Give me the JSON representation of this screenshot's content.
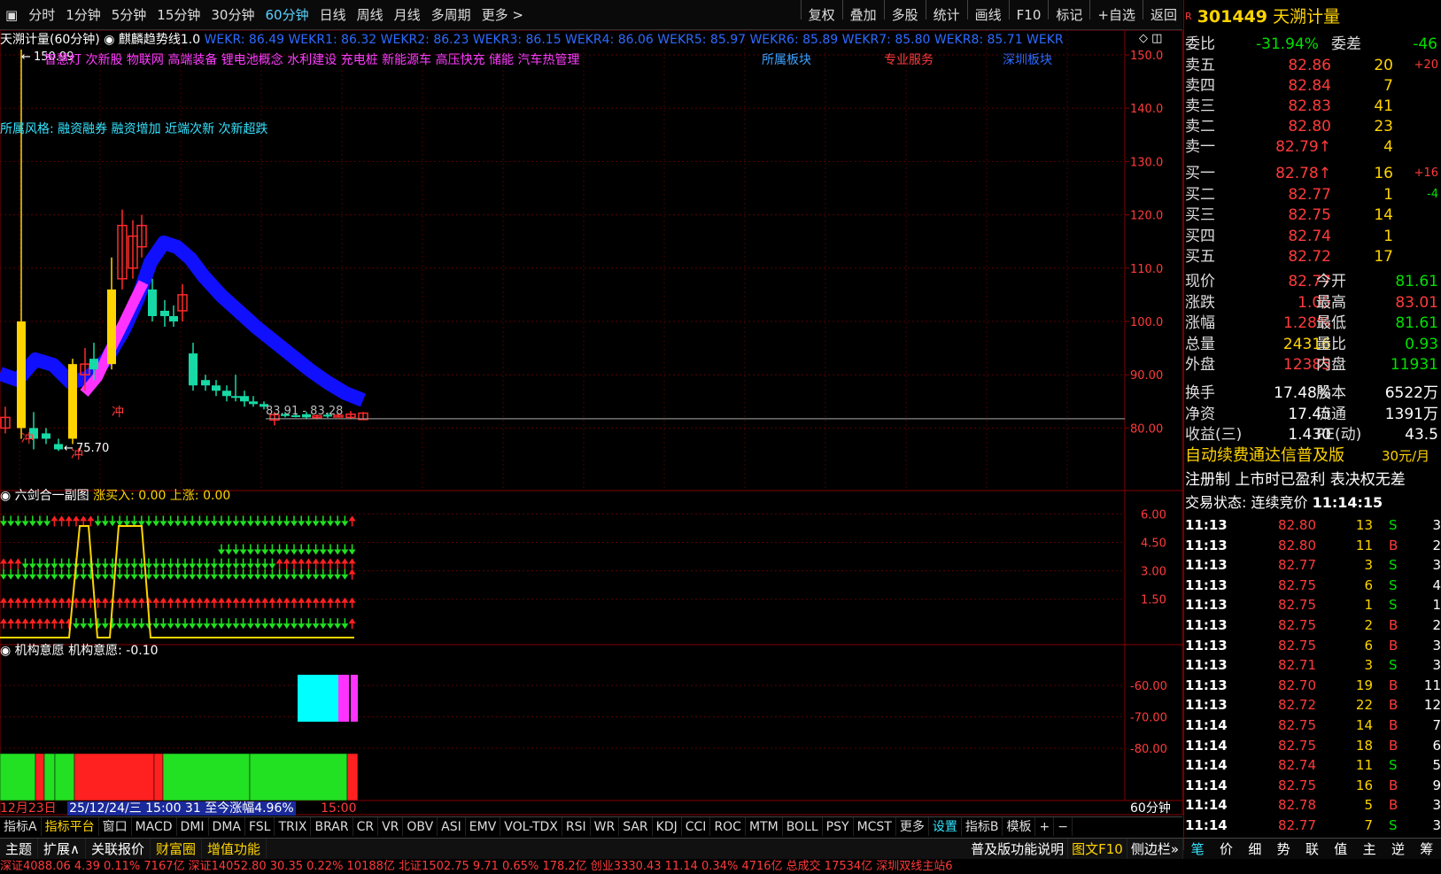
{
  "toolbar": {
    "periods": [
      "分时",
      "1分钟",
      "5分钟",
      "15分钟",
      "30分钟",
      "60分钟",
      "日线",
      "周线",
      "月线",
      "多周期",
      "更多 >"
    ],
    "active_period": "60分钟",
    "actions": [
      "复权",
      "叠加",
      "多股",
      "统计",
      "画线",
      "F10",
      "标记",
      "+自选",
      "返回"
    ]
  },
  "main_chart": {
    "title_left": "天溯计量(60分钟)",
    "indicator_name": "麒麟趋势线1.0",
    "wekr": "WEKR: 86.49 WEKR1: 86.32 WEKR2: 86.23 WEKR3: 86.15 WEKR4: 86.06 WEKR5: 85.97 WEKR6: 85.89 WEKR7: 85.80 WEKR8: 85.71 WEKR",
    "concepts": "智慧灯 次新股 物联网 高端装备 锂电池概念 水利建设 充电桩 新能源车 高压快充 储能 汽车热管理",
    "sector_label": "所属板块",
    "service_label": "专业服务",
    "region_label": "深圳板块",
    "style_label": "所属风格: 融资融券 融资增加 近端次新 次新超跌",
    "high_label": "150.99",
    "low_label": "75.70",
    "range_label": "83.91 - 83.28",
    "chong": "冲",
    "y_ticks": [
      "150.0",
      "140.0",
      "130.0",
      "120.0",
      "110.0",
      "100.0",
      "90.00",
      "80.00"
    ]
  },
  "sub1": {
    "title": "六剑合一副图",
    "value_text": "涨买入: 0.00 上涨: 0.00",
    "y_ticks": [
      "6.00",
      "4.50",
      "3.00",
      "1.50"
    ]
  },
  "sub2": {
    "title": "机构意愿",
    "value_text": "机构意愿: -0.10",
    "y_ticks": [
      "-60.00",
      "-70.00",
      "-80.00"
    ]
  },
  "time_axis": {
    "left_date": "12月23日",
    "range": "25/12/24/三 15:00 31 至今涨幅4.96%",
    "time": "15:00",
    "period_label": "60分钟"
  },
  "indicators": [
    "指标A",
    "指标平台",
    "窗口",
    "MACD",
    "DMI",
    "DMA",
    "FSL",
    "TRIX",
    "BRAR",
    "CR",
    "VR",
    "OBV",
    "ASI",
    "EMV",
    "VOL-TDX",
    "RSI",
    "WR",
    "SAR",
    "KDJ",
    "CCI",
    "ROC",
    "MTM",
    "BOLL",
    "PSY",
    "MCST",
    "更多",
    "设置",
    "指标B",
    "模板",
    "+",
    "−"
  ],
  "tabs": [
    "主题",
    "扩展∧",
    "关联报价",
    "财富圈",
    "增值功能"
  ],
  "tabs_right": [
    "普及版功能说明",
    "图文F10",
    "侧边栏»"
  ],
  "side_tabs": [
    "笔",
    "价",
    "细",
    "势",
    "联",
    "值",
    "主",
    "逆",
    "筹"
  ],
  "quote": {
    "code": "301449",
    "name": "天溯计量",
    "r_badge": "R",
    "weibi_label": "委比",
    "weibi": "-31.94%",
    "weicha_label": "委差",
    "weicha": "-46",
    "asks": [
      {
        "label": "卖五",
        "price": "82.86",
        "vol": "20",
        "chg": "+20"
      },
      {
        "label": "卖四",
        "price": "82.84",
        "vol": "7",
        "chg": ""
      },
      {
        "label": "卖三",
        "price": "82.83",
        "vol": "41",
        "chg": ""
      },
      {
        "label": "卖二",
        "price": "82.80",
        "vol": "23",
        "chg": ""
      },
      {
        "label": "卖一",
        "price": "82.79↑",
        "vol": "4",
        "chg": ""
      }
    ],
    "bids": [
      {
        "label": "买一",
        "price": "82.78↑",
        "vol": "16",
        "chg": "+16"
      },
      {
        "label": "买二",
        "price": "82.77",
        "vol": "1",
        "chg": "-4"
      },
      {
        "label": "买三",
        "price": "82.75",
        "vol": "14",
        "chg": ""
      },
      {
        "label": "买四",
        "price": "82.74",
        "vol": "1",
        "chg": ""
      },
      {
        "label": "买五",
        "price": "82.72",
        "vol": "17",
        "chg": ""
      }
    ],
    "stats": [
      {
        "l1": "现价",
        "v1": "82.77",
        "l2": "今开",
        "v2": "81.61"
      },
      {
        "l1": "涨跌",
        "v1": "1.05",
        "l2": "最高",
        "v2": "83.01"
      },
      {
        "l1": "涨幅",
        "v1": "1.28%",
        "l2": "最低",
        "v2": "81.61"
      },
      {
        "l1": "总量",
        "v1": "24316",
        "l2": "量比",
        "v2": "0.93"
      },
      {
        "l1": "外盘",
        "v1": "12385",
        "l2": "内盘",
        "v2": "11931"
      }
    ],
    "stats2": [
      {
        "l1": "换手",
        "v1": "17.48%",
        "l2": "股本",
        "v2": "6522万"
      },
      {
        "l1": "净资",
        "v1": "17.45",
        "l2": "流通",
        "v2": "1391万"
      },
      {
        "l1": "收益(三)",
        "v1": "1.430",
        "l2": "PE(动)",
        "v2": "43.5"
      }
    ],
    "promo": "自动续费通达信普及版",
    "promo_price": "30元/月",
    "notice": "注册制 上市时已盈利 表决权无差",
    "trade_state": "交易状态: 连续竞价",
    "trade_time": "11:14:15",
    "ticks": [
      [
        "11:13",
        "82.80",
        "13",
        "S",
        "3"
      ],
      [
        "11:13",
        "82.80",
        "11",
        "B",
        "2"
      ],
      [
        "11:13",
        "82.77",
        "3",
        "S",
        "3"
      ],
      [
        "11:13",
        "82.75",
        "6",
        "S",
        "4"
      ],
      [
        "11:13",
        "82.75",
        "1",
        "S",
        "1"
      ],
      [
        "11:13",
        "82.75",
        "2",
        "B",
        "2"
      ],
      [
        "11:13",
        "82.75",
        "6",
        "B",
        "3"
      ],
      [
        "11:13",
        "82.71",
        "3",
        "S",
        "3"
      ],
      [
        "11:13",
        "82.70",
        "19",
        "B",
        "11"
      ],
      [
        "11:13",
        "82.72",
        "22",
        "B",
        "12"
      ],
      [
        "11:14",
        "82.75",
        "14",
        "B",
        "7"
      ],
      [
        "11:14",
        "82.75",
        "18",
        "B",
        "6"
      ],
      [
        "11:14",
        "82.74",
        "11",
        "S",
        "5"
      ],
      [
        "11:14",
        "82.75",
        "16",
        "B",
        "9"
      ],
      [
        "11:14",
        "82.78",
        "5",
        "B",
        "3"
      ],
      [
        "11:14",
        "82.77",
        "7",
        "S",
        "3"
      ]
    ]
  },
  "status": "深证4088.06  4.39  0.11%  7167亿  深证14052.80  30.35  0.22%  10188亿 北证1502.75  9.71  0.65%  178.2亿  创业3330.43  11.14  0.34%  4716亿  总成交  17534亿  深圳双线主站6",
  "colors": {
    "up": "#ff3b3b",
    "down": "#00e000",
    "trend": "#1010ff",
    "accent": "#ffd400"
  }
}
